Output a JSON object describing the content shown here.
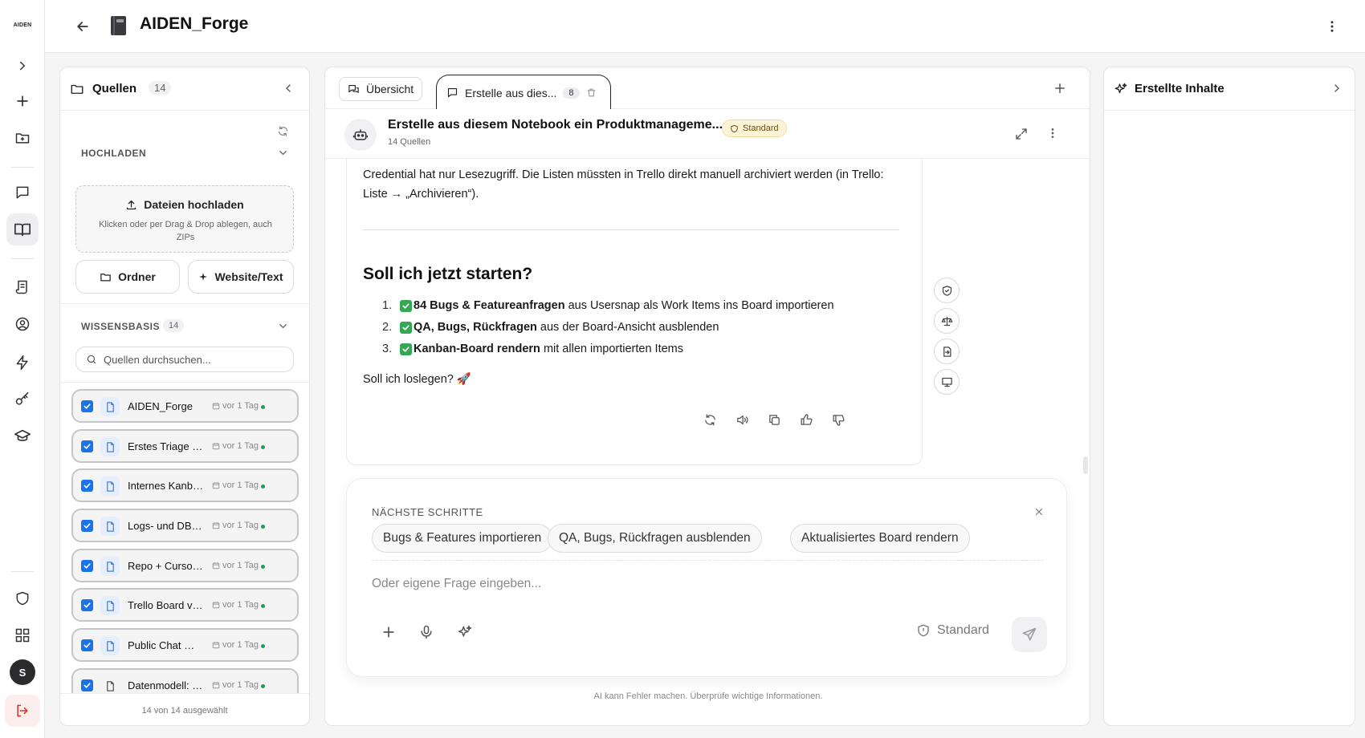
{
  "app": {
    "logo_text": "AIDEN",
    "notebook_title": "AIDEN_Forge",
    "user_initial": "S"
  },
  "rail": {
    "icons": [
      "chevron-right-icon",
      "plus-icon",
      "folder-plus-icon",
      "chat-icon",
      "book-open-icon",
      "scroll-icon",
      "user-circle-icon",
      "bolt-icon",
      "key-icon",
      "graduation-cap-icon",
      "shield-icon",
      "grid-icon",
      "logout-icon"
    ]
  },
  "sources": {
    "title": "Quellen",
    "count": "14",
    "upload_label": "HOCHLADEN",
    "upload_button": "Dateien hochladen",
    "upload_hint": "Klicken oder per Drag & Drop ablegen, auch ZIPs",
    "folder_button": "Ordner",
    "website_button": "Website/Text",
    "kb_label": "WISSENSBASIS",
    "kb_count": "14",
    "search_placeholder": "Quellen durchsuchen...",
    "items": [
      {
        "name": "AIDEN_Forge",
        "time": "vor 1 Tag"
      },
      {
        "name": "Erstes Triage Meeting",
        "time": "vor 1 Tag"
      },
      {
        "name": "Internes Kanban Board",
        "time": "vor 1 Tag"
      },
      {
        "name": "Logs- und DB-Zugriff",
        "time": "vor 1 Tag"
      },
      {
        "name": "Repo + Cursor Setup",
        "time": "vor 1 Tag"
      },
      {
        "name": "Trello Board verbinden",
        "time": "vor 1 Tag"
      },
      {
        "name": "Public Chat Widget",
        "time": "vor 1 Tag"
      },
      {
        "name": "Datenmodell: Usersnap",
        "time": "vor 1 Tag"
      }
    ],
    "footer": "14 von 14 ausgewählt"
  },
  "chat": {
    "tab_overview": "Übersicht",
    "tab_active": "Erstelle aus dies...",
    "tab_active_count": "8",
    "header_title": "Erstelle aus diesem Notebook ein Produktmanageme...",
    "header_sub": "14 Quellen",
    "mode_badge": "Standard",
    "message": {
      "para": "Credential hat nur Lesezugriff. Die Listen müssten in Trello direkt manuell archiviert werden (in Trello: Liste → „Archivieren“).",
      "heading": "Soll ich jetzt starten?",
      "steps": [
        {
          "num": "1.",
          "bold": "84 Bugs & Featureanfragen",
          "rest": " aus Usersnap als Work Items ins Board importieren"
        },
        {
          "num": "2.",
          "bold": "QA, Bugs, Rückfragen",
          "rest": " aus der Board-Ansicht ausblenden"
        },
        {
          "num": "3.",
          "bold": "Kanban-Board rendern",
          "rest": " mit allen importierten Items"
        }
      ],
      "question": "Soll ich loslegen?",
      "question_emoji": "🚀"
    },
    "next_steps_label": "NÄCHSTE SCHRITTE",
    "suggestions": [
      "Bugs & Features importieren",
      "QA, Bugs, Rückfragen ausblenden",
      "Aktualisiertes Board rendern"
    ],
    "input_placeholder": "Oder eigene Frage eingeben...",
    "mode_label": "Standard",
    "disclaimer": "AI kann Fehler machen. Überprüfe wichtige Informationen."
  },
  "right_panel": {
    "title": "Erstellte Inhalte"
  },
  "colors": {
    "accent": "#1a73e8",
    "status_dot": "#1e9e5a",
    "logout": "#d93025",
    "check": "#34a853"
  }
}
